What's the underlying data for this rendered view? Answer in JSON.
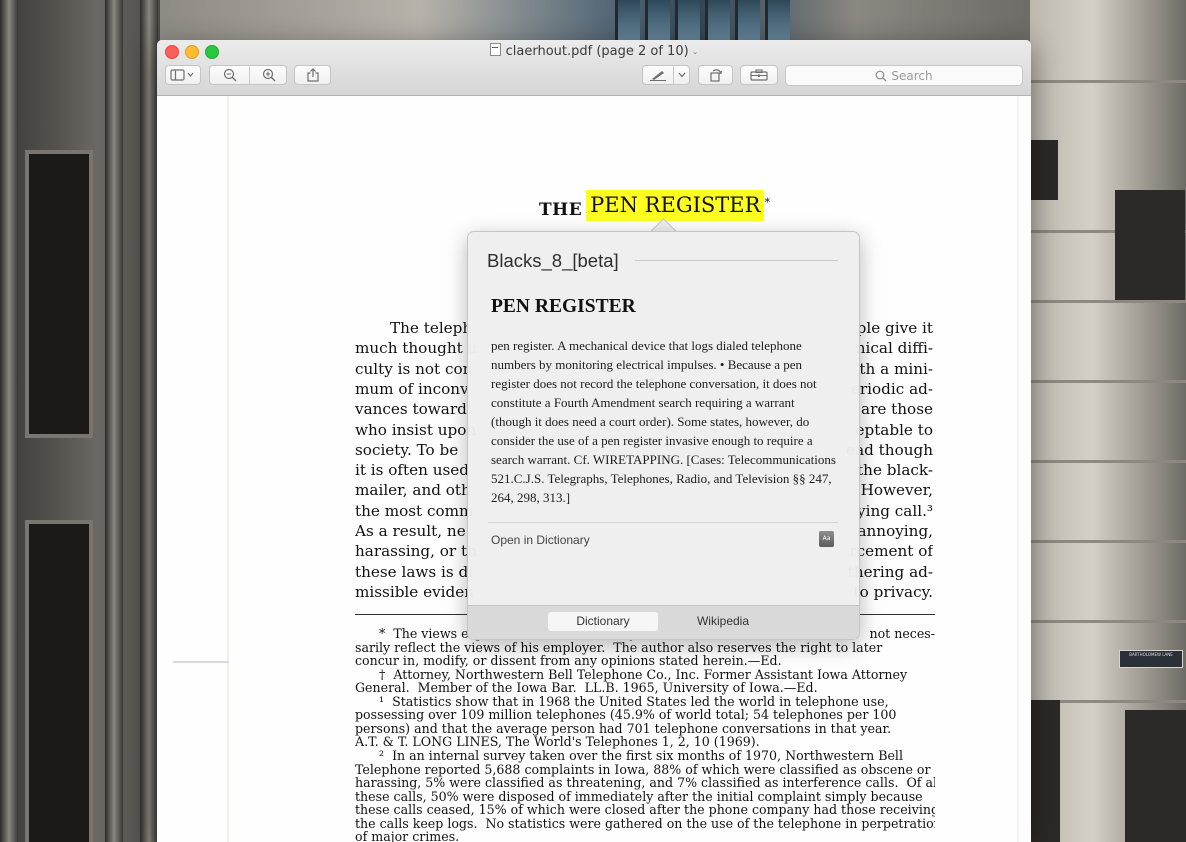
{
  "window": {
    "title": "claerhout.pdf (page 2 of 10)",
    "title_chevron": "⌄"
  },
  "toolbar": {
    "search_placeholder": "Search"
  },
  "document": {
    "heading_the": "THE",
    "heading_selected": "PEN REGISTER",
    "heading_mark": "*",
    "body_lines": [
      {
        "left": "The teleph",
        "right": "ple give it"
      },
      {
        "left": "much thought u",
        "right": "nical diffi-"
      },
      {
        "left": "culty is not con",
        "right": "th a mini-"
      },
      {
        "left": "mum of inconv",
        "right": "eriodic ad-"
      },
      {
        "left": "vances toward",
        "right": "are those"
      },
      {
        "left": "who insist upon",
        "right": "eptable to"
      },
      {
        "left": "society.  To be",
        "right": "ead though"
      },
      {
        "left": "it is often used",
        "right": "the black-"
      },
      {
        "left": "mailer, and oth",
        "right": "However,"
      },
      {
        "left": "the most comm",
        "right": "ying call.³"
      },
      {
        "left": "As a result, ne",
        "right": "annoying,"
      },
      {
        "left": "harassing, or th",
        "right": "rcement of"
      },
      {
        "left": "these laws is di",
        "right": "thering ad-"
      },
      {
        "left": "missible eviden",
        "right": "to privacy."
      }
    ],
    "footnotes": [
      {
        "left": "      *  The views expressed herein are solely those of the author and do",
        "right": "not neces-"
      },
      {
        "left": "sarily reflect the views of his employer.  The author also reserves the right to later",
        "right": ""
      },
      {
        "left": "concur in, modify, or dissent from any opinions stated herein.—Ed.",
        "right": ""
      },
      {
        "left": "      †  Attorney, Northwestern Bell Telephone Co., Inc. Former Assistant Iowa Attorney",
        "right": ""
      },
      {
        "left": "General.  Member of the Iowa Bar.  LL.B. 1965, University of Iowa.—Ed.",
        "right": ""
      },
      {
        "left": "      ¹  Statistics show that in 1968 the United States led the world in telephone use,",
        "right": ""
      },
      {
        "left": "possessing over 109 million telephones (45.9% of world total; 54 telephones per 100",
        "right": ""
      },
      {
        "left": "persons) and that the average person had 701 telephone conversations in that year.",
        "right": ""
      },
      {
        "left": "A.T. & T. LONG LINES, The World's Telephones 1, 2, 10 (1969).",
        "right": ""
      },
      {
        "left": "      ²  In an internal survey taken over the first six months of 1970, Northwestern Bell",
        "right": ""
      },
      {
        "left": "Telephone reported 5,688 complaints in Iowa, 88% of which were classified as obscene or",
        "right": ""
      },
      {
        "left": "harassing, 5% were classified as threatening, and 7% classified as interference calls.  Of all",
        "right": ""
      },
      {
        "left": "these calls, 50% were disposed of immediately after the initial complaint simply because",
        "right": ""
      },
      {
        "left": "these calls ceased, 15% of which were closed after the phone company had those receiving",
        "right": ""
      },
      {
        "left": "the calls keep logs.  No statistics were gathered on the use of the telephone in perpetration",
        "right": ""
      },
      {
        "left": "of major crimes.",
        "right": ""
      }
    ]
  },
  "popover": {
    "source": "Blacks_8_[beta]",
    "headword": "PEN REGISTER",
    "definition": "pen register. A mechanical device that logs dialed telephone numbers by monitoring electrical impulses. • Because a pen register does not record the telephone conversation, it does not constitute a Fourth Amendment search requiring a warrant (though it does need a court order). Some states, however, do consider the use of a pen register invasive enough to require a search warrant. Cf. WIRETAPPING. [Cases: Telecommunications  521.C.J.S. Telegraphs, Telephones, Radio, and Television §§ 247, 264, 298, 313.]",
    "open_link": "Open in Dictionary",
    "dict_icon_text": "Aa",
    "tabs": [
      "Dictionary",
      "Wikipedia"
    ],
    "active_tab": "Dictionary"
  },
  "background": {
    "street_sign": "BARTHOLOMEW LANE"
  }
}
